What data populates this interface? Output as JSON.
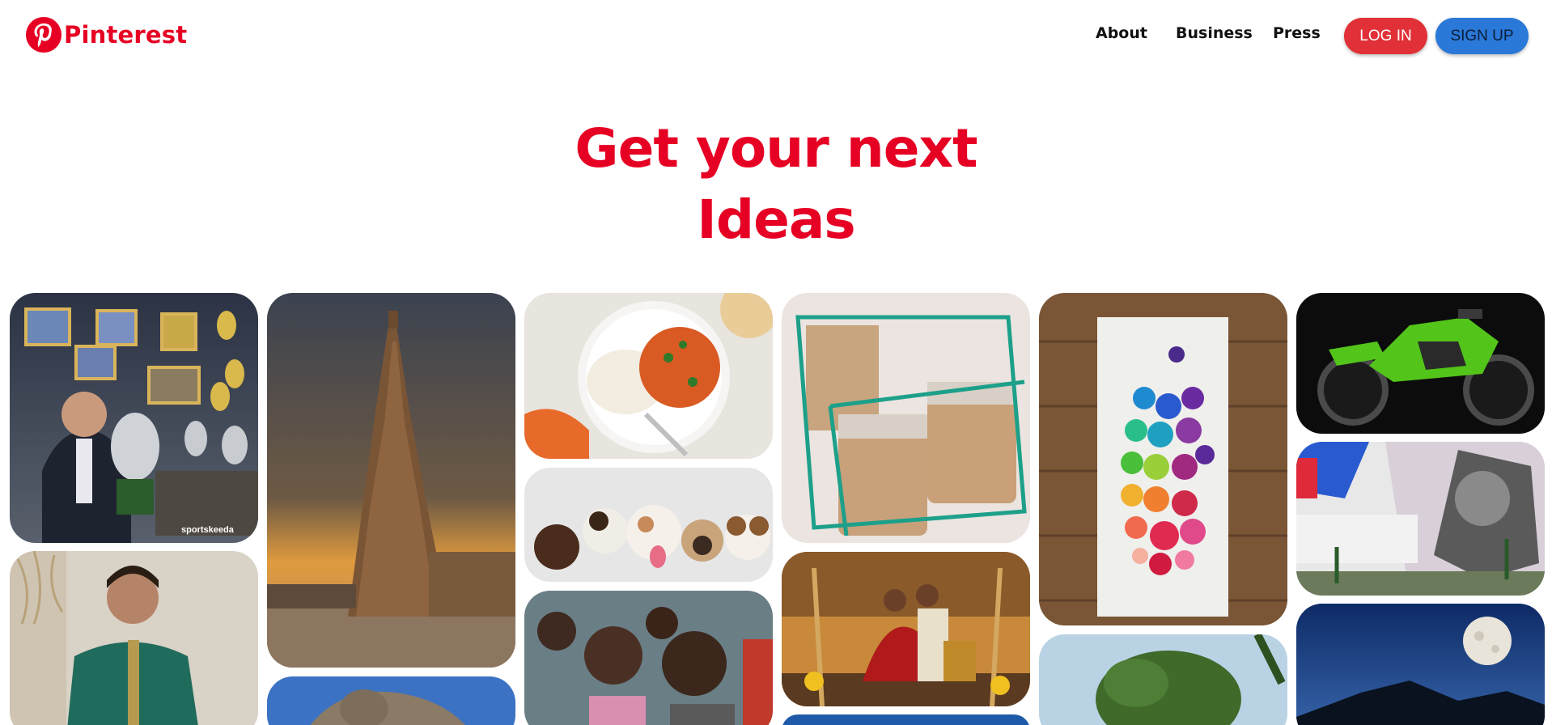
{
  "header": {
    "logo_text": "Pinterest",
    "logo_icon": "pinterest-logo-icon",
    "nav": [
      {
        "label": "About"
      },
      {
        "label": "Business"
      },
      {
        "label": "Press"
      }
    ],
    "login_label": "LOG IN",
    "signup_label": "SIGN UP"
  },
  "hero": {
    "line1": "Get your next",
    "line2": "Ideas"
  },
  "gallery": {
    "watermark": "sportskeeda"
  },
  "colors": {
    "brand_red": "#e60023",
    "login_bg": "#e13037",
    "signup_bg": "#2a78d8"
  }
}
